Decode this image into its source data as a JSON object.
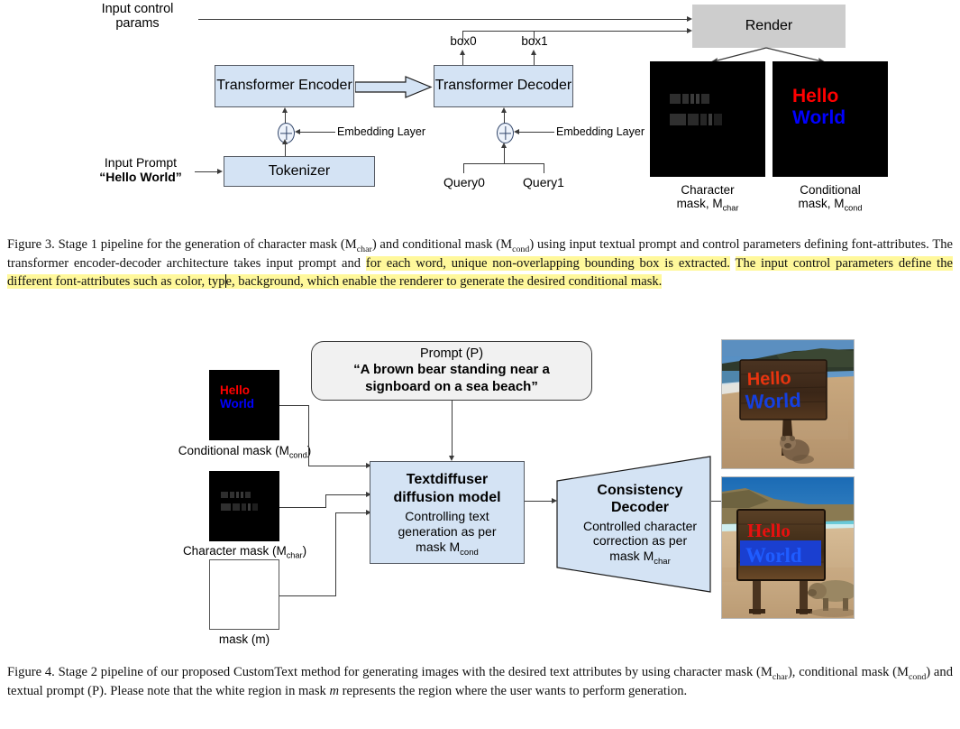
{
  "figure3": {
    "nodes": {
      "input_control_params": "Input control\nparams",
      "transformer_encoder": "Transformer\nEncoder",
      "transformer_decoder": "Transformer\nDecoder",
      "tokenizer": "Tokenizer",
      "render": "Render",
      "box0": "box0",
      "box1": "box1",
      "query0": "Query0",
      "query1": "Query1",
      "embedding_layer_left": "Embedding Layer",
      "embedding_layer_right": "Embedding Layer",
      "input_prompt_label": "Input Prompt",
      "input_prompt_value": "“Hello World”"
    },
    "char_mask_caption": "Character\nmask, M",
    "char_mask_sub": "char",
    "cond_mask_caption": "Conditional\nmask, M",
    "cond_mask_sub": "cond",
    "cond_mask_text": {
      "line1": "Hello",
      "line2": "World"
    },
    "colors": {
      "box_fill": "#d4e3f4",
      "box_stroke": "#555a63",
      "render_fill": "#cdcdcd",
      "hello_red": "#ff0000",
      "world_blue": "#0000ff",
      "line": "#3a3a3a"
    }
  },
  "caption3": {
    "lead": "Figure 3.",
    "seg1": " Stage 1 pipeline for the generation of character mask (M",
    "sub1": "char",
    "seg2": ") and conditional mask (M",
    "sub2": "cond",
    "seg3": ") using input textual prompt and control parameters defining font-attributes.  The transformer encoder-decoder architecture takes input prompt and ",
    "hl1": "for each word, unique non-overlapping bounding box is extracted.",
    "seg4": "  ",
    "hl2": "The input control parameters define the different font-attributes such as color, typ",
    "hl3": "e, background, which enable the renderer to generate the desired conditional mask.",
    "highlight_color": "#fff89b"
  },
  "figure4": {
    "cond_mask_label": "Conditional mask (M",
    "cond_mask_sub": "cond",
    "cond_mask_label_end": ")",
    "cond_mask_text": {
      "line1": "Hello",
      "line2": "World"
    },
    "char_mask_label": "Character mask (M",
    "char_mask_sub": "char",
    "char_mask_label_end": ")",
    "white_mask_label": "mask (m)",
    "prompt": {
      "title": "Prompt (P)",
      "text": "“A brown bear standing near a\nsignboard on a sea beach”"
    },
    "textdiffuser": {
      "title": "Textdiffuser\ndiffusion model",
      "sub1": "Controlling text\ngeneration as per\nmask M",
      "sub_sub": "cond"
    },
    "consistency": {
      "title": "Consistency\nDecoder",
      "sub1": "Controlled character\ncorrection as per\nmask M",
      "sub_sub": "char"
    },
    "photos": [
      {
        "name": "beach-sign-bear-cub",
        "sign_line1": "Hello",
        "sign_line2": "World"
      },
      {
        "name": "beach-sign-bear-walking",
        "sign_line1": "Hello",
        "sign_line2": "World"
      }
    ]
  },
  "caption4": {
    "lead": "Figure 4.",
    "seg1": " Stage 2 pipeline of our proposed CustomText method for generating images with the desired text attributes by using character mask (M",
    "sub1": "char",
    "seg2": "), conditional mask (M",
    "sub2": "cond",
    "seg3": ") and textual prompt (P). Please note that the white region in mask ",
    "mi1": "m",
    "seg4": " represents the region where the user wants to perform generation."
  }
}
